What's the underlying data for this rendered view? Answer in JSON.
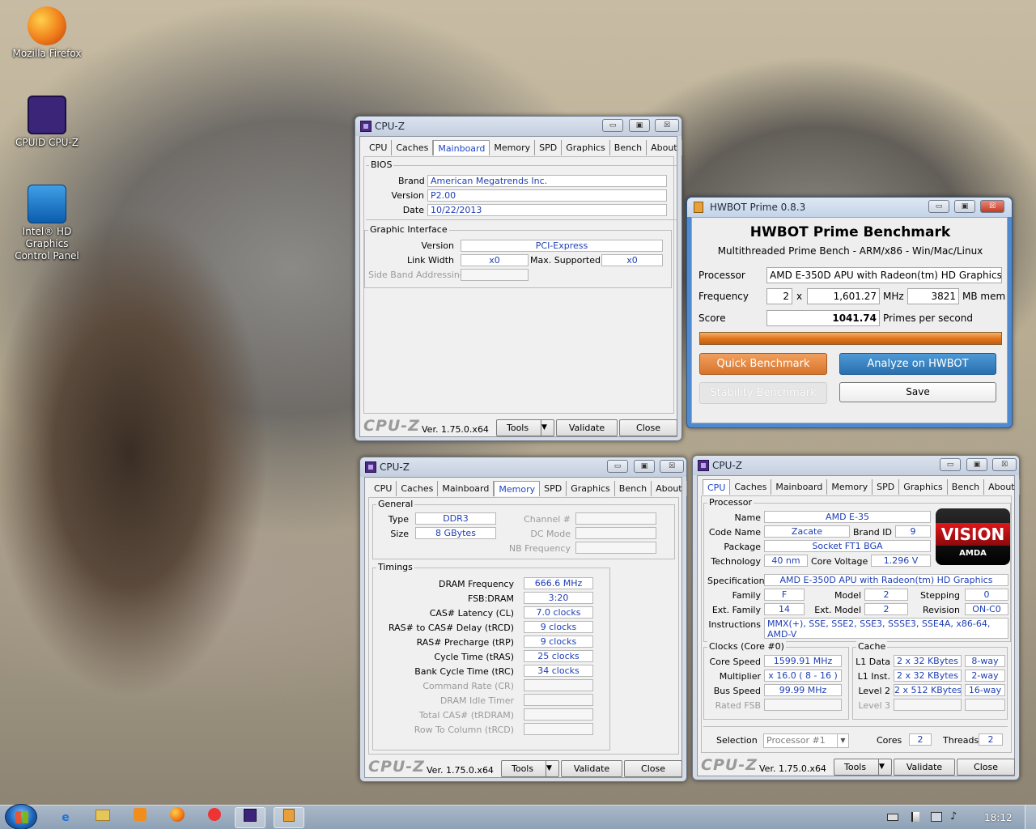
{
  "desktop": {
    "icons": [
      {
        "label": "Mozilla Firefox",
        "icon": "firefox-icon"
      },
      {
        "label": "CPUID CPU-Z",
        "icon": "cpuz-icon"
      },
      {
        "label": "Intel® HD Graphics Control Panel",
        "icon": "intel-graphics-icon"
      }
    ]
  },
  "common": {
    "logo": "CPU-Z",
    "version": "Ver. 1.75.0.x64",
    "tools": "Tools",
    "validate": "Validate",
    "close": "Close",
    "minimize": "▭",
    "maximize": "▣",
    "close_x": "☒"
  },
  "cpuz_mainboard": {
    "title": "CPU-Z",
    "tabs": [
      "CPU",
      "Caches",
      "Mainboard",
      "Memory",
      "SPD",
      "Graphics",
      "Bench",
      "About"
    ],
    "bios": {
      "title": "BIOS",
      "brand_label": "Brand",
      "brand": "American Megatrends Inc.",
      "version_label": "Version",
      "version": "P2.00",
      "date_label": "Date",
      "date": "10/22/2013"
    },
    "gi": {
      "title": "Graphic Interface",
      "version_label": "Version",
      "version": "PCI-Express",
      "link_label": "Link Width",
      "link": "x0",
      "max_label": "Max. Supported",
      "max": "x0",
      "sba_label": "Side Band Addressing"
    }
  },
  "cpuz_memory": {
    "title": "CPU-Z",
    "tabs": [
      "CPU",
      "Caches",
      "Mainboard",
      "SPD",
      "Graphics",
      "Bench",
      "About"
    ],
    "active_tab": "Memory",
    "general": {
      "title": "General",
      "type_label": "Type",
      "type": "DDR3",
      "size_label": "Size",
      "size": "8 GBytes",
      "channel_label": "Channel #",
      "dc_label": "DC Mode",
      "nb_label": "NB Frequency"
    },
    "timings": {
      "title": "Timings",
      "rows": [
        {
          "label": "DRAM Frequency",
          "value": "666.6 MHz"
        },
        {
          "label": "FSB:DRAM",
          "value": "3:20"
        },
        {
          "label": "CAS# Latency (CL)",
          "value": "7.0 clocks"
        },
        {
          "label": "RAS# to CAS# Delay (tRCD)",
          "value": "9 clocks"
        },
        {
          "label": "RAS# Precharge (tRP)",
          "value": "9 clocks"
        },
        {
          "label": "Cycle Time (tRAS)",
          "value": "25 clocks"
        },
        {
          "label": "Bank Cycle Time (tRC)",
          "value": "34 clocks"
        }
      ],
      "dim_rows": [
        "Command Rate (CR)",
        "DRAM Idle Timer",
        "Total CAS# (tRDRAM)",
        "Row To Column (tRCD)"
      ]
    }
  },
  "cpuz_cpu": {
    "title": "CPU-Z",
    "tabs": [
      "CPU",
      "Caches",
      "Mainboard",
      "Memory",
      "SPD",
      "Graphics",
      "Bench",
      "About"
    ],
    "processor": {
      "title": "Processor",
      "name_label": "Name",
      "name": "AMD E-35",
      "code_label": "Code Name",
      "code": "Zacate",
      "brand_label": "Brand ID",
      "brand": "9",
      "package_label": "Package",
      "package": "Socket FT1 BGA",
      "tech_label": "Technology",
      "tech": "40 nm",
      "voltage_label": "Core Voltage",
      "voltage": "1.296 V",
      "spec_label": "Specification",
      "spec": "AMD E-350D APU with Radeon(tm) HD Graphics",
      "family_label": "Family",
      "family": "F",
      "model_label": "Model",
      "model": "2",
      "stepping_label": "Stepping",
      "stepping": "0",
      "extfam_label": "Ext. Family",
      "extfam": "14",
      "extmodel_label": "Ext. Model",
      "extmodel": "2",
      "rev_label": "Revision",
      "rev": "ON-C0",
      "instr_label": "Instructions",
      "instr": "MMX(+), SSE, SSE2, SSE3, SSSE3, SSE4A, x86-64, AMD-V"
    },
    "logo": {
      "word": "VISION",
      "brand": "AMDA"
    },
    "clocks": {
      "title": "Clocks (Core #0)",
      "speed_label": "Core Speed",
      "speed": "1599.91 MHz",
      "mult_label": "Multiplier",
      "mult": "x 16.0 ( 8 - 16 )",
      "bus_label": "Bus Speed",
      "bus": "99.99 MHz",
      "fsb_label": "Rated FSB"
    },
    "cache": {
      "title": "Cache",
      "rows": [
        {
          "label": "L1 Data",
          "size": "2 x 32 KBytes",
          "way": "8-way"
        },
        {
          "label": "L1 Inst.",
          "size": "2 x 32 KBytes",
          "way": "2-way"
        },
        {
          "label": "Level 2",
          "size": "2 x 512 KBytes",
          "way": "16-way"
        }
      ],
      "l3_label": "Level 3"
    },
    "selection_label": "Selection",
    "selection": "Processor #1",
    "cores_label": "Cores",
    "cores": "2",
    "threads_label": "Threads",
    "threads": "2"
  },
  "hwbot": {
    "title": "HWBOT Prime 0.8.3",
    "heading": "HWBOT Prime Benchmark",
    "subheading": "Multithreaded Prime Bench - ARM/x86 - Win/Mac/Linux",
    "processor_label": "Processor",
    "processor": "AMD E-350D APU with Radeon(tm) HD Graphics",
    "frequency_label": "Frequency",
    "cores": "2",
    "x": "x",
    "mhz_value": "1,601.27",
    "mhz": "MHz",
    "mem_value": "3821",
    "mem": "MB mem",
    "score_label": "Score",
    "score": "1041.74",
    "score_unit": "Primes per second",
    "progress": 1.0,
    "quick": "Quick Benchmark",
    "analyze": "Analyze on HWBOT",
    "stability": "Stability Benchmark",
    "save": "Save"
  },
  "taskbar": {
    "clock": "18:12"
  }
}
